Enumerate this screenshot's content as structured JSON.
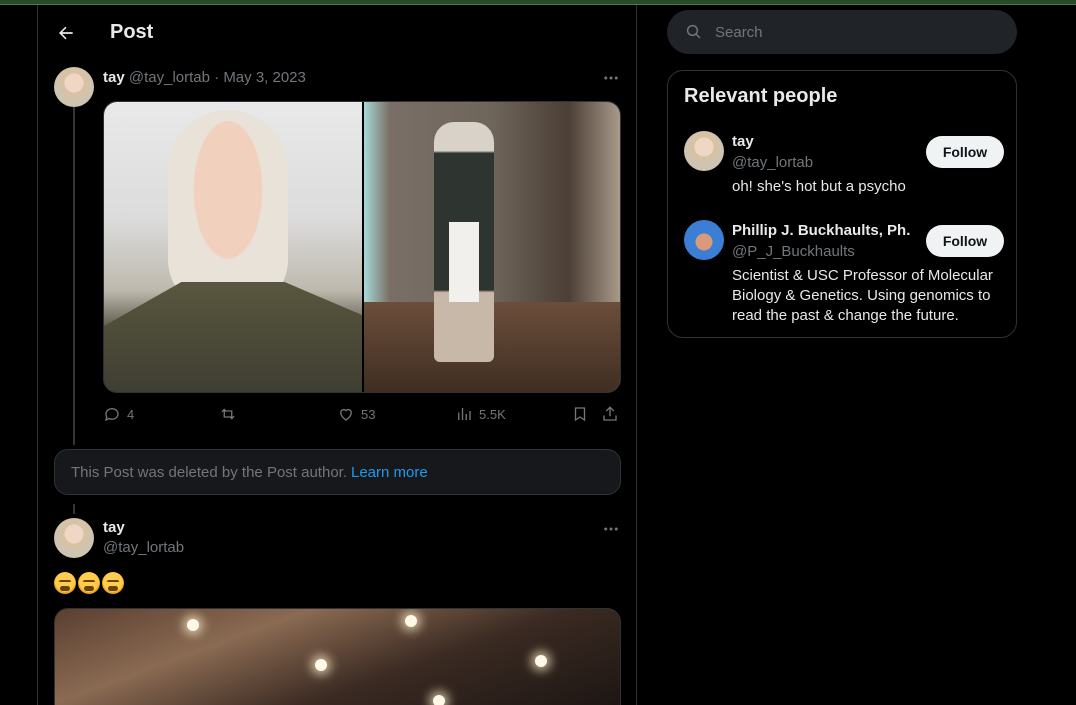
{
  "header": {
    "title": "Post"
  },
  "tweet1": {
    "name": "tay",
    "handle": "@tay_lortab",
    "date": "May 3, 2023",
    "stats": {
      "replies": "4",
      "likes": "53",
      "views": "5.5K"
    }
  },
  "deleted_notice": {
    "text": "This Post was deleted by the Post author.",
    "link": "Learn more"
  },
  "tweet3": {
    "name": "tay",
    "handle": "@tay_lortab"
  },
  "search": {
    "placeholder": "Search"
  },
  "relevant": {
    "title": "Relevant people",
    "people": [
      {
        "name": "tay",
        "handle": "@tay_lortab",
        "bio": "oh! she's hot but a psycho",
        "button": "Follow"
      },
      {
        "name": "Phillip J. Buckhaults, Ph.D",
        "handle": "@P_J_Buckhaults",
        "bio": "Scientist & USC Professor of Molecular Biology & Genetics. Using genomics to read the past & change the future.",
        "button": "Follow"
      }
    ]
  },
  "colors": {
    "accent": "#1d9bf0",
    "background": "#000000",
    "muted": "#71767b"
  }
}
